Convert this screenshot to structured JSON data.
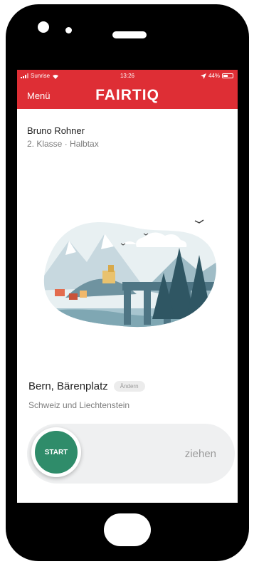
{
  "status_bar": {
    "carrier": "Sunrise",
    "time": "13:26",
    "battery": "44%",
    "wifi_icon": "wifi-icon",
    "location_icon": "location-arrow-icon"
  },
  "nav": {
    "menu_label": "Menü",
    "brand": "FAIRTIQ",
    "color": "#de2e35"
  },
  "user": {
    "name": "Bruno Rohner",
    "class_info": "2. Klasse · Halbtax"
  },
  "location": {
    "name": "Bern, Bärenplatz",
    "change_label": "Ändern",
    "region": "Schweiz und Liechtenstein"
  },
  "slider": {
    "start_label": "START",
    "hint": "ziehen",
    "knob_color": "#2f8c6a"
  }
}
